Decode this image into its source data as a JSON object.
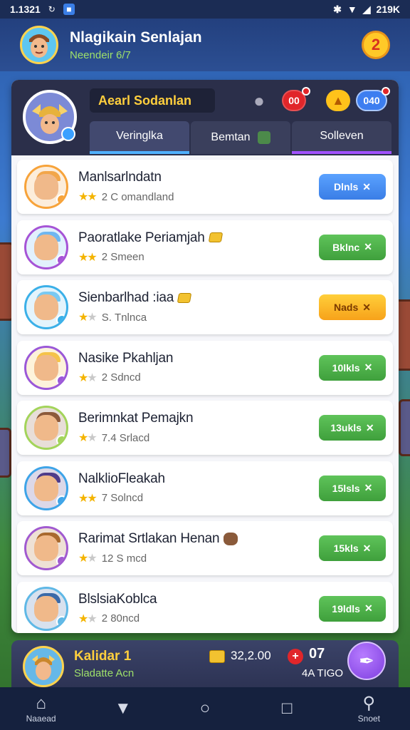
{
  "status_bar": {
    "time": "1.1321",
    "right_text": "219K"
  },
  "header": {
    "name": "Nlagikain Senlajan",
    "subtitle": "Neendeir 6/7",
    "badge": "2"
  },
  "panel": {
    "title": "Aearl Sodanlan",
    "red_badge": "00",
    "blue_badge": "040",
    "tabs": [
      {
        "label": "Veringlka"
      },
      {
        "label": "Bemtan"
      },
      {
        "label": "Solleven"
      }
    ]
  },
  "rows": [
    {
      "name": "Manlsarlndatn",
      "stars": "2",
      "sub": "C omandland",
      "button": "Dlnls",
      "color": "#f2a64a",
      "ring": "#f7a33a"
    },
    {
      "name": "Paoratlake Periamjah",
      "stars": "2",
      "sub": "Smeen",
      "button": "Bklnc",
      "color": "#6fb7f0",
      "ring": "#a654d6"
    },
    {
      "name": "Sienbarlhad :iaa",
      "stars": "S.",
      "sub": "Tnlnca",
      "button": "Nads",
      "color": "#79c9f2",
      "ring": "#3bb0e8"
    },
    {
      "name": "Nasike Pkahljan",
      "stars": "2",
      "sub": "Sdncd",
      "button": "10lkls",
      "color": "#f5c34a",
      "ring": "#9b58d8"
    },
    {
      "name": "Berimnkat Pemajkn",
      "stars": "7.4",
      "sub": "Srlacd",
      "button": "13ukls",
      "color": "#8c5a3a",
      "ring": "#a3d45a"
    },
    {
      "name": "NalklioFleakah",
      "stars": "7",
      "sub": "Solncd",
      "button": "15lsls",
      "color": "#4f3c8a",
      "ring": "#3ea4e8"
    },
    {
      "name": "Rarimat Srtlakan Henan",
      "stars": "12",
      "sub": "S mcd",
      "button": "15kls",
      "color": "#a8692e",
      "ring": "#a15ad0"
    },
    {
      "name": "BlslsiaKoblca",
      "stars": "2",
      "sub": "80ncd",
      "button": "19ldls",
      "color": "#3a6aa8",
      "ring": "#5fb8e6"
    }
  ],
  "bottom_card": {
    "name": "Kalidar",
    "rank": "1",
    "subtitle": "Sladatte Acn",
    "score": "32,2.00",
    "stat": "07",
    "stat2": "4A TIGO"
  },
  "nav": [
    {
      "label": "Naaead",
      "icon": "home-icon"
    },
    {
      "label": "",
      "icon": "back-icon"
    },
    {
      "label": "",
      "icon": "circle-icon"
    },
    {
      "label": "",
      "icon": "square-icon"
    },
    {
      "label": "Snoet",
      "icon": "search-icon"
    }
  ]
}
